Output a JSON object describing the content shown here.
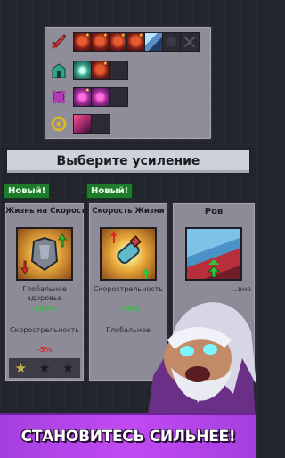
{
  "header": {
    "title": "Выберите усиление"
  },
  "upgrades": {
    "rows": [
      {
        "icon": "sword-icon",
        "slots": [
          "filled-red",
          "filled-red",
          "filled-red",
          "filled-red",
          "filled-blue",
          "locked",
          "empty-x"
        ]
      },
      {
        "icon": "tower-icon",
        "slots": [
          "filled-teal",
          "filled-red",
          "empty"
        ]
      },
      {
        "icon": "magic-icon",
        "slots": [
          "filled-purple",
          "filled-purple",
          "empty"
        ]
      },
      {
        "icon": "gold-icon",
        "slots": [
          "filled-pink",
          "empty"
        ]
      }
    ]
  },
  "cards": [
    {
      "badge": "Новый!",
      "title": "Жизнь на Скорости",
      "stat1_label": "Глобальное здоровье",
      "stat1_value": "+30%",
      "stat2_label": "Скорострельность",
      "stat2_value": "-5%",
      "stars_filled": 1
    },
    {
      "badge": "Новый!",
      "title": "Скорость Жизни",
      "stat1_label": "Скорострельность",
      "stat1_value": "+30%",
      "stat2_label": "Глобальное",
      "stat2_value": ""
    },
    {
      "title": "Ров",
      "stat1_label": "...вно"
    }
  ],
  "banner": {
    "text": "СТАНОВИТЕСЬ СИЛЬНЕЕ!"
  },
  "colors": {
    "accent": "#b845ec",
    "bonus_up": "#2bc43a",
    "bonus_down": "#e0262a",
    "badge": "#1e7b2c"
  }
}
